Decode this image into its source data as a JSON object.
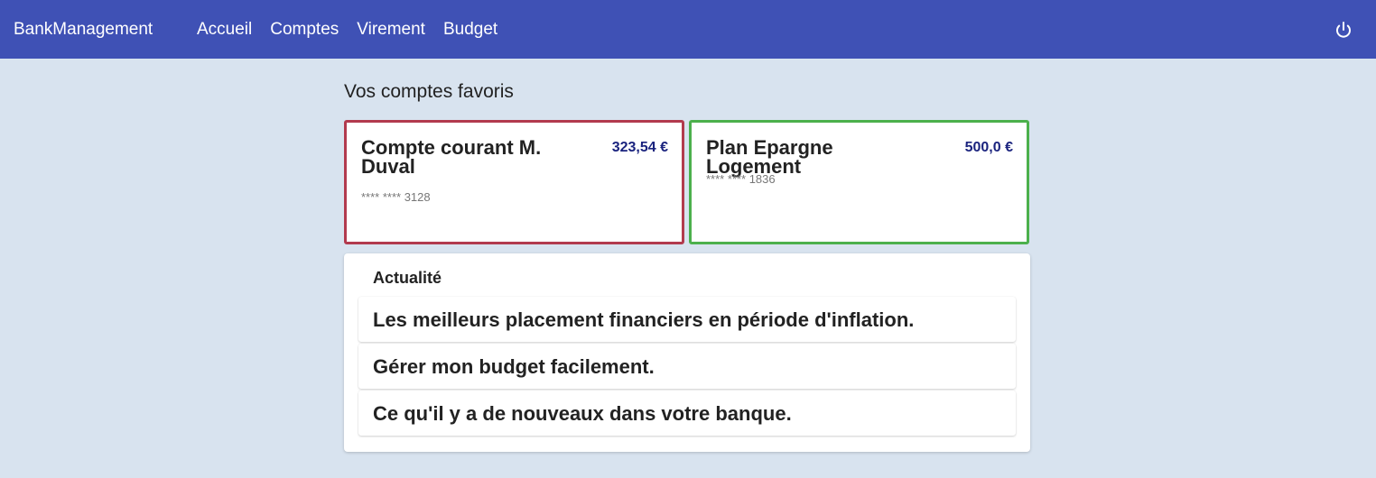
{
  "header": {
    "brand": "BankManagement",
    "nav": [
      "Accueil",
      "Comptes",
      "Virement",
      "Budget"
    ],
    "logout_icon": "power-icon"
  },
  "favorites": {
    "title": "Vos comptes favoris",
    "accounts": [
      {
        "name": "Compte courant M. Duval",
        "balance": "323,54 €",
        "number": "**** **** 3128",
        "color": "#b23a4e"
      },
      {
        "name": "Plan Epargne Logement",
        "balance": "500,0 €",
        "number": "**** **** 1836",
        "color": "#4cb04c"
      }
    ]
  },
  "news": {
    "title": "Actualité",
    "items": [
      "Les meilleurs placement financiers en période d'inflation.",
      "Gérer mon budget facilement.",
      "Ce qu'il y a de nouveaux dans votre banque."
    ]
  },
  "colors": {
    "primary": "#3f51b5",
    "background": "#d8e3ef",
    "balance": "#1a237e"
  }
}
